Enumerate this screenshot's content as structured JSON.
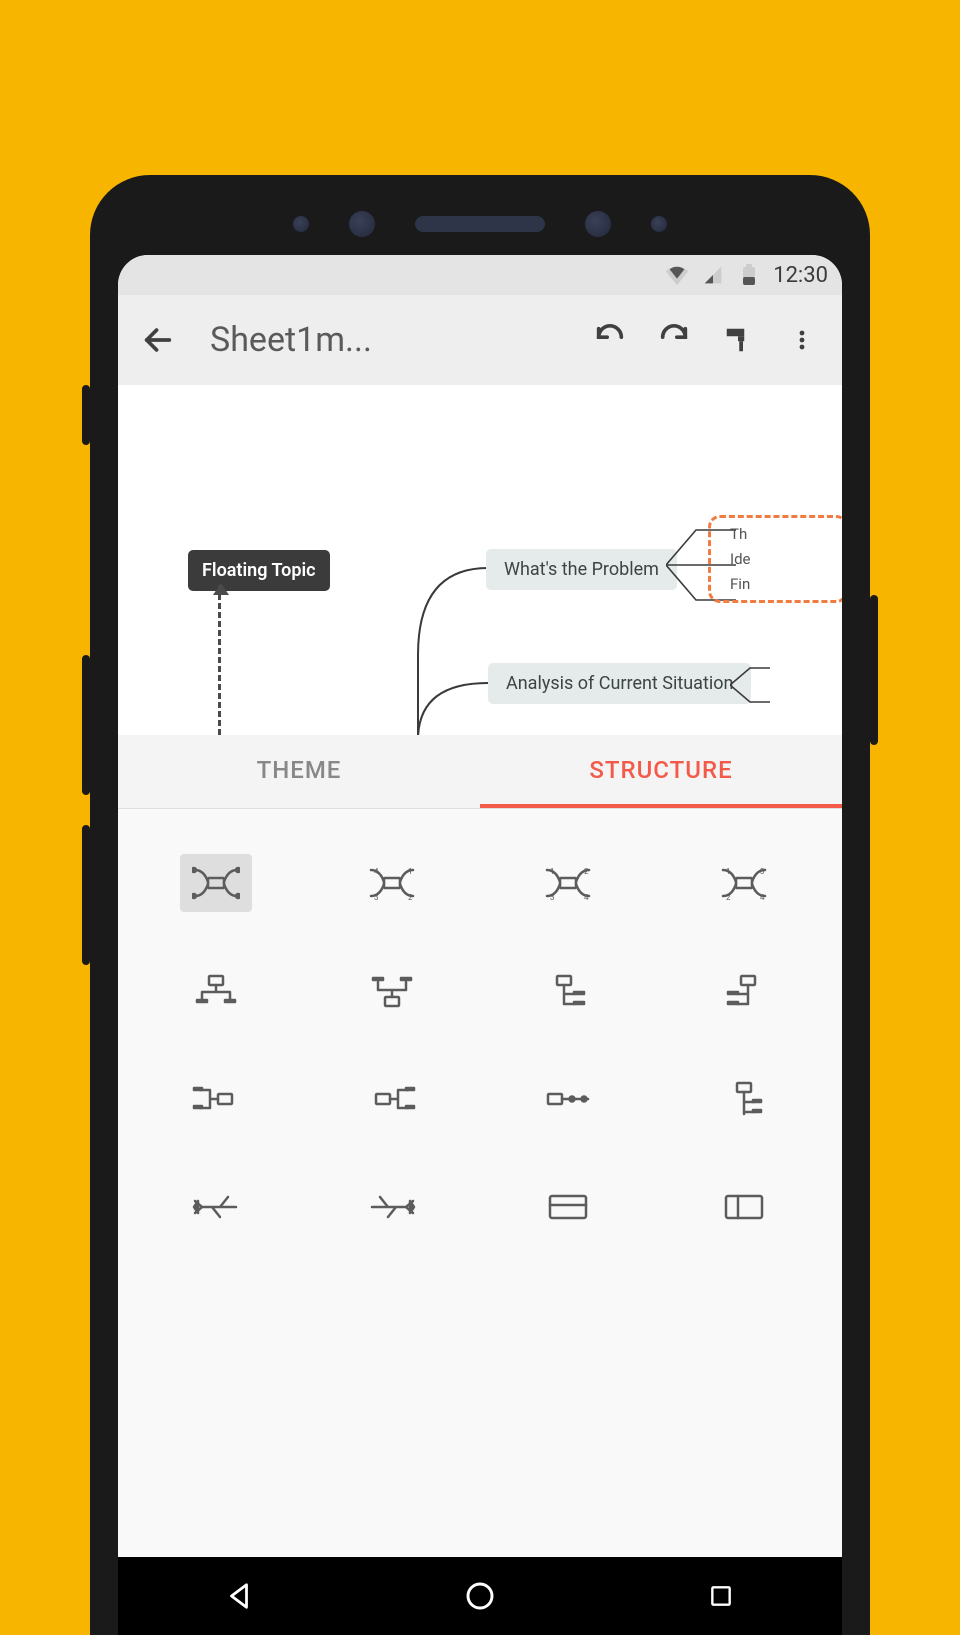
{
  "status_bar": {
    "time": "12:30"
  },
  "app_bar": {
    "title": "Sheet1m..."
  },
  "canvas": {
    "floating_topic": "Floating Topic",
    "node1": "What's the Problem",
    "node2": "Analysis of Current Situation",
    "mini1": "Th",
    "mini2": "Ide",
    "mini3": "Fin"
  },
  "tabs": {
    "theme": "THEME",
    "structure": "STRUCTURE",
    "active": "structure"
  },
  "structure_options": [
    {
      "name": "balanced-map",
      "selected": true
    },
    {
      "name": "map-clockwise",
      "selected": false
    },
    {
      "name": "map-anticlockwise",
      "selected": false
    },
    {
      "name": "map-bidirectional",
      "selected": false
    },
    {
      "name": "org-chart-down",
      "selected": false
    },
    {
      "name": "org-chart-up",
      "selected": false
    },
    {
      "name": "tree-right",
      "selected": false
    },
    {
      "name": "tree-left",
      "selected": false
    },
    {
      "name": "logic-right",
      "selected": false
    },
    {
      "name": "logic-left",
      "selected": false
    },
    {
      "name": "timeline-horizontal",
      "selected": false
    },
    {
      "name": "timeline-vertical",
      "selected": false
    },
    {
      "name": "fishbone-left",
      "selected": false
    },
    {
      "name": "fishbone-right",
      "selected": false
    },
    {
      "name": "spreadsheet-row",
      "selected": false
    },
    {
      "name": "spreadsheet-column",
      "selected": false
    }
  ]
}
